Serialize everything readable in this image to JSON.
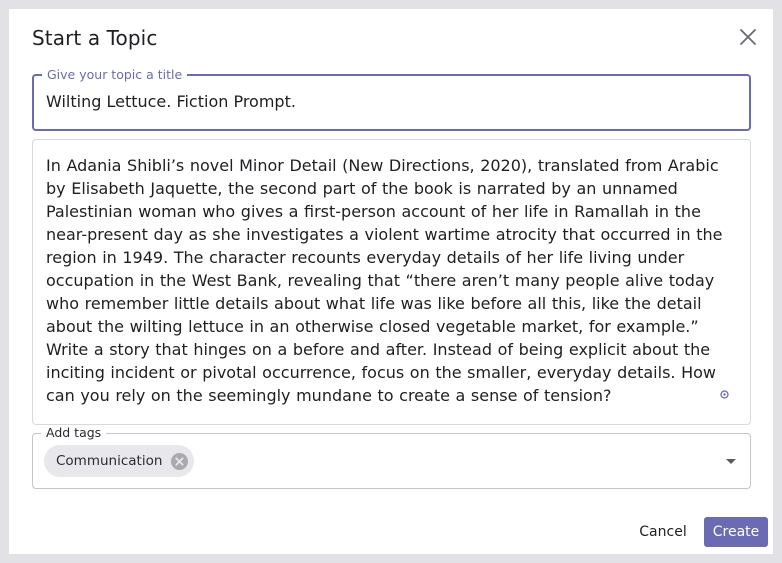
{
  "dialog": {
    "title": "Start a Topic",
    "close_icon": "close-icon"
  },
  "topic_title": {
    "label": "Give your topic a title",
    "value": "Wilting Lettuce. Fiction Prompt."
  },
  "topic_body": {
    "value": "In Adania Shibli’s novel Minor Detail (New Directions, 2020), translated from Arabic by Elisabeth Jaquette, the second part of the book is narrated by an unnamed Palestinian woman who gives a first-person account of her life in Ramallah in the near-present day as she investigates a violent wartime atrocity that occurred in the region in 1949. The character recounts everyday details of her life living under occupation in the West Bank, revealing that “there aren’t many people alive today who remember little details about what life was like before all this, like the detail about the wilting lettuce in an otherwise closed vegetable market, for example.” Write a story that hinges on a before and after. Instead of being explicit about the inciting incident or pivotal occurrence, focus on the smaller, everyday details. How can you rely on the seemingly mundane to create a sense of tension?"
  },
  "tags": {
    "label": "Add tags",
    "selected": [
      "Communication"
    ],
    "chip_delete_icon": "cancel-circle-icon",
    "dropdown_icon": "caret-down-icon"
  },
  "actions": {
    "cancel_label": "Cancel",
    "create_label": "Create"
  },
  "colors": {
    "accent": "#6b6bb4",
    "text": "#1f1f23",
    "backdrop": "#e2e2e6",
    "chip_bg": "#e8e8ec"
  }
}
